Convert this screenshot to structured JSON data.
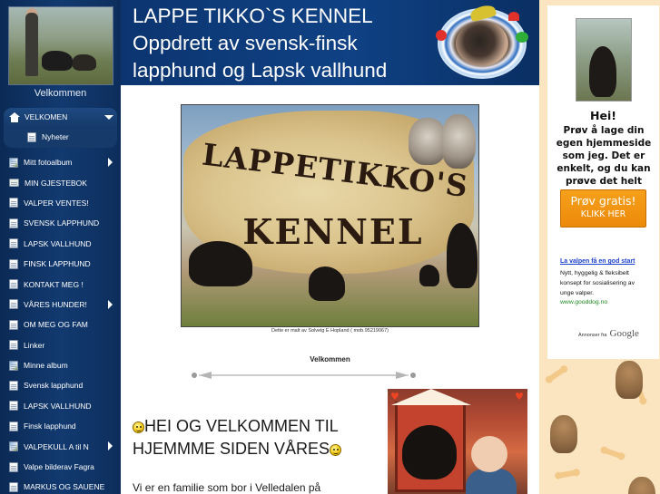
{
  "sidebar": {
    "welcome": "Velkommen",
    "items": [
      {
        "label": "VELKOMEN",
        "icon": "home-icon",
        "arrow": true,
        "active": true
      },
      {
        "label": "Nyheter",
        "icon": "page-icon",
        "sub": true
      },
      {
        "label": "Mitt fotoalbum",
        "icon": "photo-icon",
        "arrow": true
      },
      {
        "label": "MIN GJESTEBOK",
        "icon": "book-icon"
      },
      {
        "label": "VALPER VENTES!",
        "icon": "page-icon"
      },
      {
        "label": "SVENSK LAPPHUND",
        "icon": "page-icon"
      },
      {
        "label": "LAPSK VALLHUND",
        "icon": "page-icon"
      },
      {
        "label": "FINSK LAPPHUND",
        "icon": "page-icon"
      },
      {
        "label": "KONTAKT MEG !",
        "icon": "page-icon"
      },
      {
        "label": "VÅRES HUNDER!",
        "icon": "page-icon",
        "arrow": true
      },
      {
        "label": "OM MEG OG FAM",
        "icon": "page-icon"
      },
      {
        "label": "Linker",
        "icon": "page-icon"
      },
      {
        "label": "Minne album",
        "icon": "photo-icon"
      },
      {
        "label": "Svensk lapphund",
        "icon": "page-icon"
      },
      {
        "label": "LAPSK VALLHUND",
        "icon": "page-icon"
      },
      {
        "label": "Finsk lapphund",
        "icon": "page-icon"
      },
      {
        "label": "VALPEKULL A til N",
        "icon": "photo-icon",
        "arrow": true
      },
      {
        "label": "Valpe bilderav Fagra",
        "icon": "page-icon"
      },
      {
        "label": "MARKUS OG SAUENE",
        "icon": "page-icon"
      }
    ]
  },
  "header": {
    "title_lines": [
      "LAPPE TIKKO`S KENNEL",
      "Oppdrett av svensk-finsk",
      "lapphund og Lapsk vallhund"
    ]
  },
  "main": {
    "sign_line1": "LAPPETIKKO'S",
    "sign_line2": "KENNEL",
    "sign_caption": "Dette er malt av Solveig E Hopland ( mob.95219067)",
    "welcome": "Velkommen",
    "greeting_line1": "HEI OG VELKOMMEN TIL",
    "greeting_line2": "HJEMMME SIDEN VÅRES",
    "intro": "Vi er en familie som bor i Velledalen på"
  },
  "promo": {
    "hei": "Hei!",
    "text": "Prøv å lage din egen hjemmeside som jeg. Det er enkelt, og du kan prøve det helt gratis.",
    "button_line1": "Prøv gratis!",
    "button_line2": "KLIKK HER"
  },
  "ad": {
    "link": "La valpen få en god start",
    "body": "Nytt, hyggelig & fleksibelt konsept for sosialisering av unge valper.",
    "url": "www.gooddog.no",
    "choice_label": "Annonser fra",
    "brand": "Google"
  },
  "colors": {
    "sidebar": "#0f3568",
    "header": "#0f4184",
    "promo_button": "#f29413",
    "ad_link": "#1a3fcc",
    "ad_url": "#1f8a1f"
  }
}
